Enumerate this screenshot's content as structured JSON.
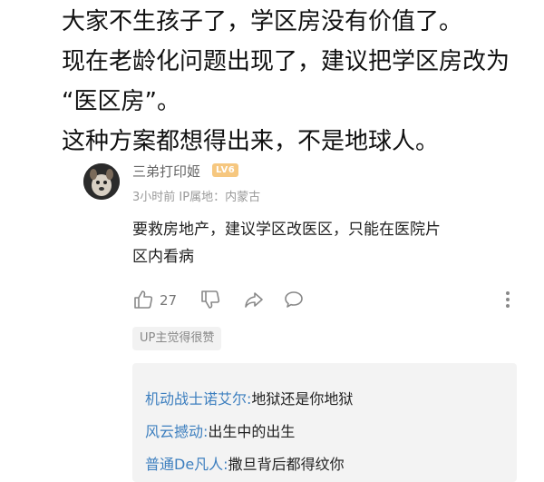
{
  "post": {
    "lines": [
      "大家不生孩子了，学区房没有价值了。",
      "现在老龄化问题出现了，建议把学区房改为",
      "“医区房”。",
      "这种方案都想得出来，不是地球人。"
    ]
  },
  "comment": {
    "username": "三弟打印姬",
    "level_badge": "LV6",
    "meta": "3小时前  IP属地：内蒙古",
    "text_lines": [
      "要救房地产，建议学区改医区，只能在医院片",
      "区内看病"
    ],
    "like_count": "27",
    "up_badge": "UP主觉得很赞",
    "icons": {
      "like": "thumbs-up-icon",
      "dislike": "thumbs-down-icon",
      "share": "share-icon",
      "reply": "comment-icon",
      "more": "more-vertical-icon"
    }
  },
  "replies": [
    {
      "user": "机动战士诺艾尔:",
      "text": "地狱还是你地狱"
    },
    {
      "user": "风云撼动:",
      "text": "出生中的出生"
    },
    {
      "user": "普通De凡人:",
      "text": "撒旦背后都得纹你"
    }
  ],
  "colors": {
    "reply_user": "#3d7fbf",
    "badge": "#f6c77f",
    "reply_bg": "#f3f3f3"
  }
}
